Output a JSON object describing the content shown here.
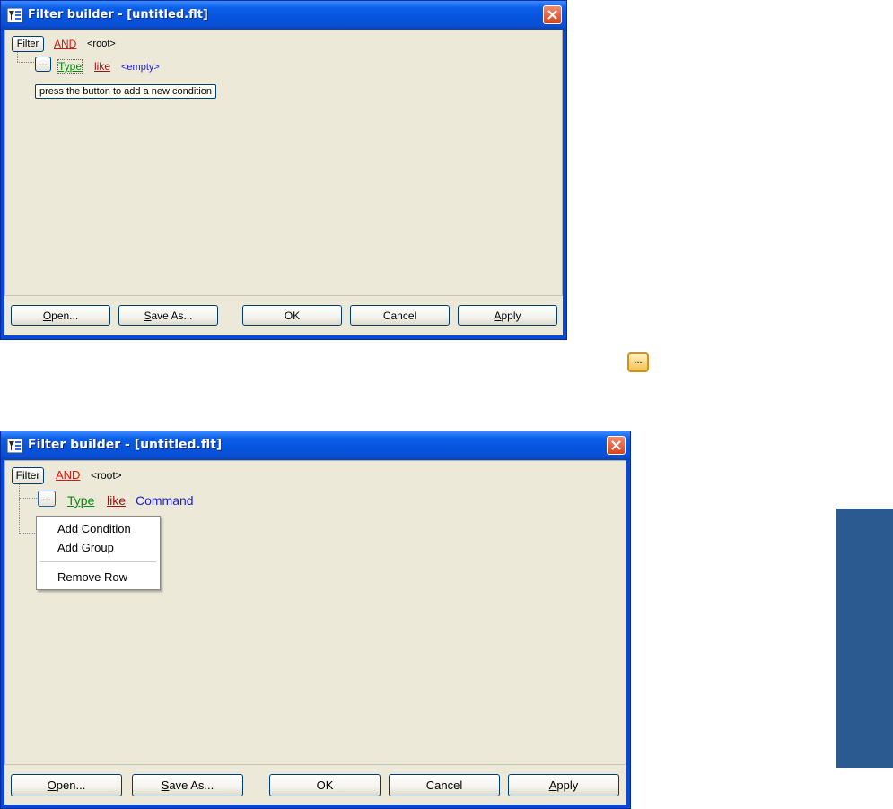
{
  "windows": [
    {
      "title": "Filter builder - [untitled.flt]",
      "filter_button": "Filter",
      "group_operator": "AND",
      "group_label": "<root>",
      "condition": {
        "ellipsis": "...",
        "field": "Type",
        "comparison": "like",
        "value": "<empty>"
      },
      "hint": "press the button to add a new condition",
      "buttons": {
        "open": "Open...",
        "save_as": "Save As...",
        "ok": "OK",
        "cancel": "Cancel",
        "apply": "Apply"
      }
    },
    {
      "title": "Filter builder - [untitled.flt]",
      "filter_button": "Filter",
      "group_operator": "AND",
      "group_label": "<root>",
      "condition": {
        "ellipsis": "...",
        "field": "Type",
        "comparison": "like",
        "value": "Command"
      },
      "context_menu": [
        "Add Condition",
        "Add Group",
        "Remove Row"
      ],
      "buttons": {
        "open": "Open...",
        "save_as": "Save As...",
        "ok": "OK",
        "cancel": "Cancel",
        "apply": "Apply"
      }
    }
  ],
  "floating_icon_label": "...",
  "colors": {
    "titlebar": "#0653dc",
    "client": "#ece9d8",
    "operator": "#e0130c",
    "field": "#008c0c",
    "comparison": "#9c1010",
    "value": "#1c1cd6",
    "side_bar": "#2a5a90"
  }
}
